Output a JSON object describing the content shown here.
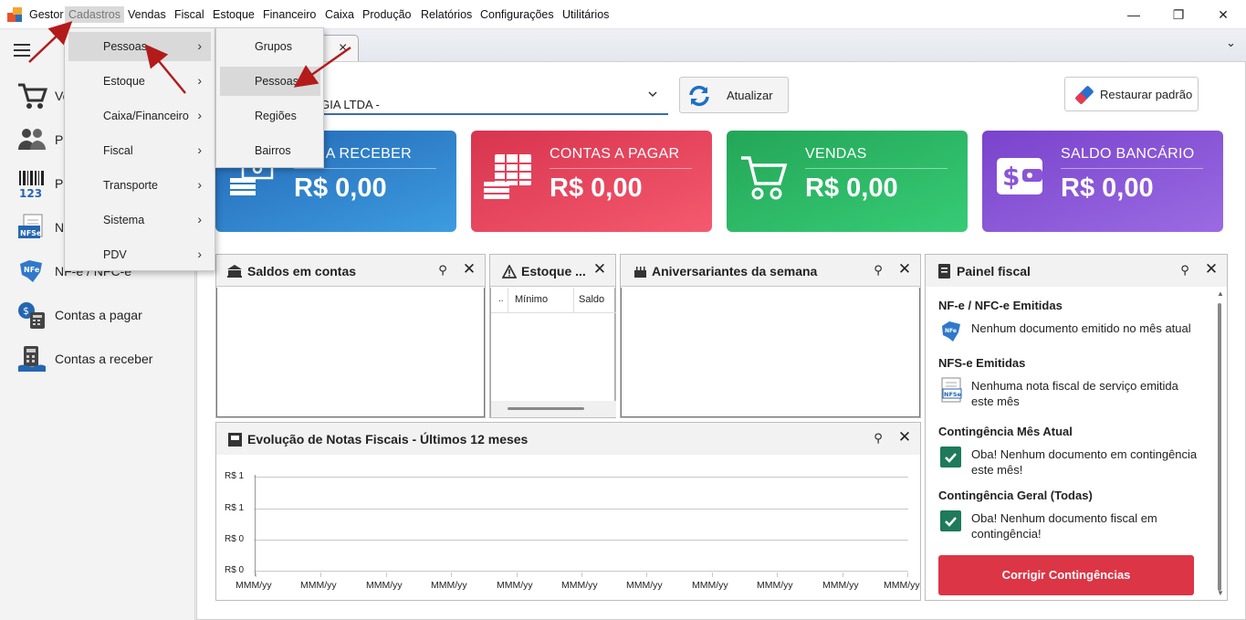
{
  "menubar": {
    "logo_label": "Gestor",
    "items": [
      "Cadastros",
      "Vendas",
      "Fiscal",
      "Estoque",
      "Financeiro",
      "Caixa",
      "Produção",
      "Relatórios",
      "Configurações",
      "Utilitários"
    ],
    "active_item": "Cadastros"
  },
  "window_controls": {
    "minimize": "—",
    "maximize": "❐",
    "close": "✕"
  },
  "sidebar": {
    "items": [
      {
        "label": "Ve",
        "icon": "cart-icon"
      },
      {
        "label": "Pe",
        "icon": "people-icon"
      },
      {
        "label": "Pr",
        "icon": "barcode-icon"
      },
      {
        "label": "N",
        "icon": "nfse-icon"
      },
      {
        "label": "NF-e / NFC-e",
        "icon": "nfe-icon"
      },
      {
        "label": "Contas a pagar",
        "icon": "bill-calculator-icon"
      },
      {
        "label": "Contas a receber",
        "icon": "receive-calculator-icon"
      }
    ]
  },
  "cadastros_menu": {
    "items": [
      "Pessoas",
      "Estoque",
      "Caixa/Financeiro",
      "Fiscal",
      "Transporte",
      "Sistema",
      "PDV"
    ],
    "highlighted": "Pessoas"
  },
  "pessoas_submenu": {
    "items": [
      "Grupos",
      "Pessoas",
      "Regiões",
      "Bairros"
    ],
    "highlighted": "Pessoas"
  },
  "tab": {
    "close_label": "×"
  },
  "toolbar": {
    "company_value": "OGIA LTDA -",
    "refresh_label": "Atualizar",
    "restore_label": "Restaurar padrão"
  },
  "cards": [
    {
      "title": "TAS A RECEBER",
      "value": "R$ 0,00",
      "color": "#2b7bc0",
      "icon": "money-stack-icon"
    },
    {
      "title": "CONTAS A PAGAR",
      "value": "R$ 0,00",
      "color": "#e6405a",
      "icon": "bill-stack-icon"
    },
    {
      "title": "VENDAS",
      "value": "R$ 0,00",
      "color": "#2bb864",
      "icon": "cart-icon"
    },
    {
      "title": "SALDO BANCÁRIO",
      "value": "R$ 0,00",
      "color": "#8a55d6",
      "icon": "wallet-icon"
    }
  ],
  "panels": {
    "saldos": {
      "title": "Saldos em contas"
    },
    "estoque": {
      "title": "Estoque ...",
      "columns": [
        "..",
        "Mínimo",
        "Saldo"
      ]
    },
    "aniversariantes": {
      "title": "Aniversariantes da semana"
    },
    "evolucao": {
      "title": "Evolução de Notas Fiscais - Últimos 12 meses"
    },
    "fiscal": {
      "title": "Painel fiscal",
      "sections": [
        {
          "heading": "NF-e / NFC-e Emitidas",
          "text": "Nenhum documento emitido no mês atual"
        },
        {
          "heading": "NFS-e Emitidas",
          "text": "Nenhuma nota fiscal de serviço emitida este mês"
        },
        {
          "heading": "Contingência Mês Atual",
          "text": "Oba! Nenhum documento em contingência este mês!"
        },
        {
          "heading": "Contingência Geral (Todas)",
          "text": "Oba! Nenhum documento fiscal em contingência!"
        }
      ],
      "button_label": "Corrigir Contingências",
      "button_color": "#dc3545"
    }
  },
  "chart_data": {
    "type": "line",
    "title": "Evolução de Notas Fiscais - Últimos 12 meses",
    "y_tick_labels": [
      "R$ 1",
      "R$ 1",
      "R$ 0",
      "R$ 0"
    ],
    "x_tick_labels": [
      "MMM/yy",
      "MMM/yy",
      "MMM/yy",
      "MMM/yy",
      "MMM/yy",
      "MMM/yy",
      "MMM/yy",
      "MMM/yy",
      "MMM/yy",
      "MMM/yy",
      "MMM/yy"
    ],
    "series": []
  }
}
